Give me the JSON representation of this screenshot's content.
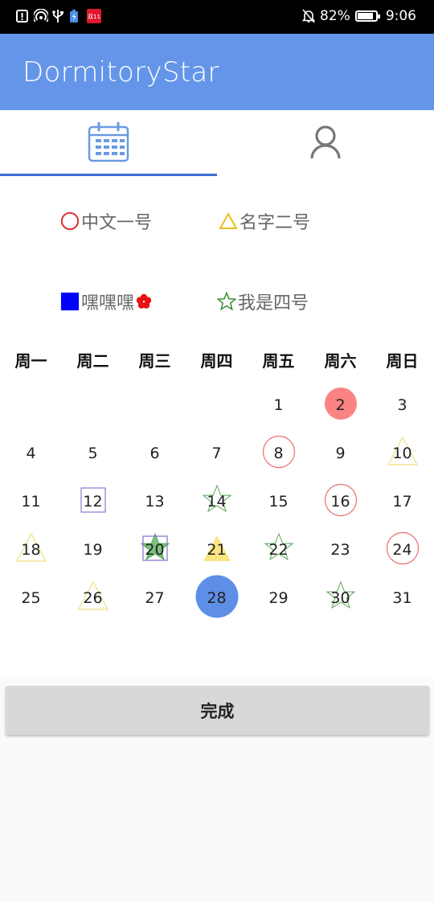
{
  "status_bar": {
    "battery": "82%",
    "time": "9:06",
    "icons": [
      "alert-icon",
      "hotspot-icon",
      "usb-icon",
      "battery-saver-icon",
      "app-notification-icon",
      "silent-icon"
    ]
  },
  "app": {
    "title": "DormitoryStar",
    "bar_color": "#6495e8"
  },
  "tabs": [
    {
      "icon": "calendar-icon",
      "selected": true
    },
    {
      "icon": "person-icon",
      "selected": false
    }
  ],
  "legend": [
    {
      "symbol": "circle",
      "name": "中文一号",
      "color": "#e03030"
    },
    {
      "symbol": "triangle",
      "name": "名字二号",
      "color": "#e8c020"
    },
    {
      "symbol": "square",
      "name": "嘿嘿嘿",
      "color": "#0000ff",
      "suffix_icon": "flower-icon"
    },
    {
      "symbol": "star",
      "name": "我是四号",
      "color": "#2e8b2e"
    }
  ],
  "calendar": {
    "weekdays": [
      "周一",
      "周二",
      "周三",
      "周四",
      "周五",
      "周六",
      "周日"
    ],
    "first_weekday_index": 4,
    "days_in_month": 31,
    "today": 28,
    "marks": {
      "2": "circle-filled",
      "8": "circle",
      "10": "triangle",
      "12": "square",
      "14": "star",
      "16": "circle",
      "18": "triangle",
      "20": "star-filled-square",
      "21": "triangle-filled",
      "22": "star",
      "24": "circle",
      "26": "triangle",
      "30": "star"
    }
  },
  "done_button": {
    "label": "完成"
  }
}
